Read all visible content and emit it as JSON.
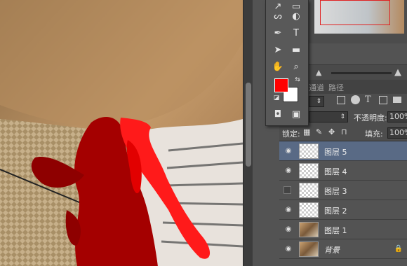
{
  "tabs": {
    "channels": "通道",
    "paths": "路径"
  },
  "blend": {
    "mode": "",
    "opacity_label": "不透明度:",
    "opacity_value": "100%"
  },
  "lock": {
    "label": "锁定:",
    "fill_label": "填充:",
    "fill_value": "100%"
  },
  "layers": [
    {
      "name": "图层 5",
      "visible": true,
      "active": true,
      "thumb": "transparent"
    },
    {
      "name": "图层 4",
      "visible": true,
      "active": false,
      "thumb": "transparent"
    },
    {
      "name": "图层 3",
      "visible": false,
      "active": false,
      "thumb": "transparent"
    },
    {
      "name": "图层 2",
      "visible": true,
      "active": false,
      "thumb": "transparent"
    },
    {
      "name": "图层 1",
      "visible": true,
      "active": false,
      "thumb": "image"
    },
    {
      "name": "背景",
      "visible": true,
      "active": false,
      "thumb": "image",
      "locked": true
    }
  ],
  "colors": {
    "foreground": "#ff0000",
    "background": "#ffffff",
    "selected_layer": "#596a85"
  },
  "icons": [
    "path-select-icon",
    "pen-icon",
    "brush-icon",
    "type-icon",
    "arrow-icon",
    "rectangle-icon",
    "hand-icon",
    "zoom-icon",
    "eye-icon",
    "lock-icon"
  ]
}
